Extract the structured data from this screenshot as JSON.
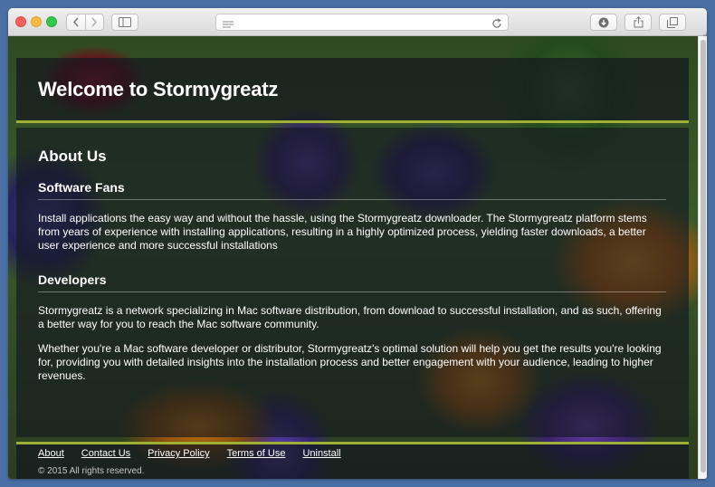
{
  "browser": {
    "address_text": ""
  },
  "page": {
    "header": {
      "title": "Welcome to Stormygreatz"
    },
    "main": {
      "heading": "About Us",
      "sections": [
        {
          "title": "Software Fans",
          "paragraphs": [
            "Install applications the easy way and without the hassle, using the Stormygreatz downloader. The Stormygreatz platform stems from years of experience with installing applications, resulting in a highly optimized process, yielding faster downloads, a better user experience and more successful installations"
          ]
        },
        {
          "title": "Developers",
          "paragraphs": [
            "Stormygreatz is a network specializing in Mac software distribution, from download to successful installation, and as such, offering a better way for you to reach the Mac software community.",
            "Whether you're a Mac software developer or distributor, Stormygreatz's optimal solution will help you get the results you're looking for, providing you with detailed insights into the installation process and better engagement with your audience, leading to higher revenues."
          ]
        }
      ]
    },
    "footer": {
      "links": [
        "About",
        "Contact Us",
        "Privacy Policy",
        "Terms of Use",
        "Uninstall"
      ],
      "copyright": "© 2015 All rights reserved."
    }
  },
  "colors": {
    "accent": "#9db035",
    "panel_bg": "#141820"
  }
}
